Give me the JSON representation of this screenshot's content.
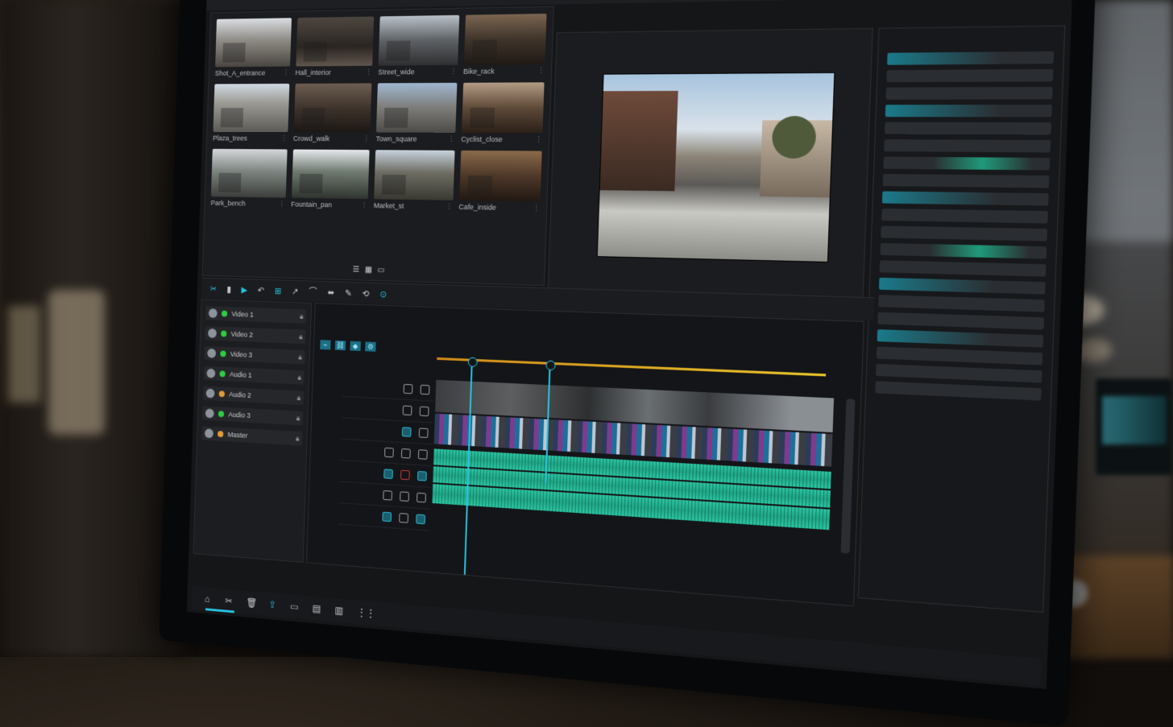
{
  "app": {
    "window_title": "",
    "top_label": ""
  },
  "media_bin": {
    "clips": [
      {
        "name": "Shot_A_entrance"
      },
      {
        "name": "Hall_interior"
      },
      {
        "name": "Street_wide"
      },
      {
        "name": "Bike_rack"
      },
      {
        "name": "Plaza_trees"
      },
      {
        "name": "Crowd_walk"
      },
      {
        "name": "Town_square"
      },
      {
        "name": "Cyclist_close"
      },
      {
        "name": "Park_bench"
      },
      {
        "name": "Fountain_pan"
      },
      {
        "name": "Market_st"
      },
      {
        "name": "Cafe_inside"
      }
    ],
    "footer_left": "",
    "footer_right": ""
  },
  "program_monitor": {
    "tab_label": "",
    "timecode": ""
  },
  "right_panel": {
    "label": ""
  },
  "toolbar": {
    "tools": [
      "✂",
      "▮",
      "▶",
      "↶",
      "⊞",
      "↗",
      "⌒",
      "⬌",
      "✎",
      "⟲",
      "⊙"
    ]
  },
  "tracks": {
    "items": [
      {
        "name": "Video 1",
        "dot": "green"
      },
      {
        "name": "Video 2",
        "dot": "green"
      },
      {
        "name": "Video 3",
        "dot": "green"
      },
      {
        "name": "Audio 1",
        "dot": "green"
      },
      {
        "name": "Audio 2",
        "dot": "orange"
      },
      {
        "name": "Audio 3",
        "dot": "green"
      },
      {
        "name": "Master",
        "dot": "orange"
      }
    ],
    "footer_label": ""
  },
  "timeline": {
    "header": "",
    "sequence_name": "",
    "ruler": [
      "",
      "",
      "",
      "",
      "",
      ""
    ],
    "colors": {
      "accent": "#27c3e0",
      "audio": "#2bc7a3",
      "work_area": "#e6c22a"
    }
  }
}
